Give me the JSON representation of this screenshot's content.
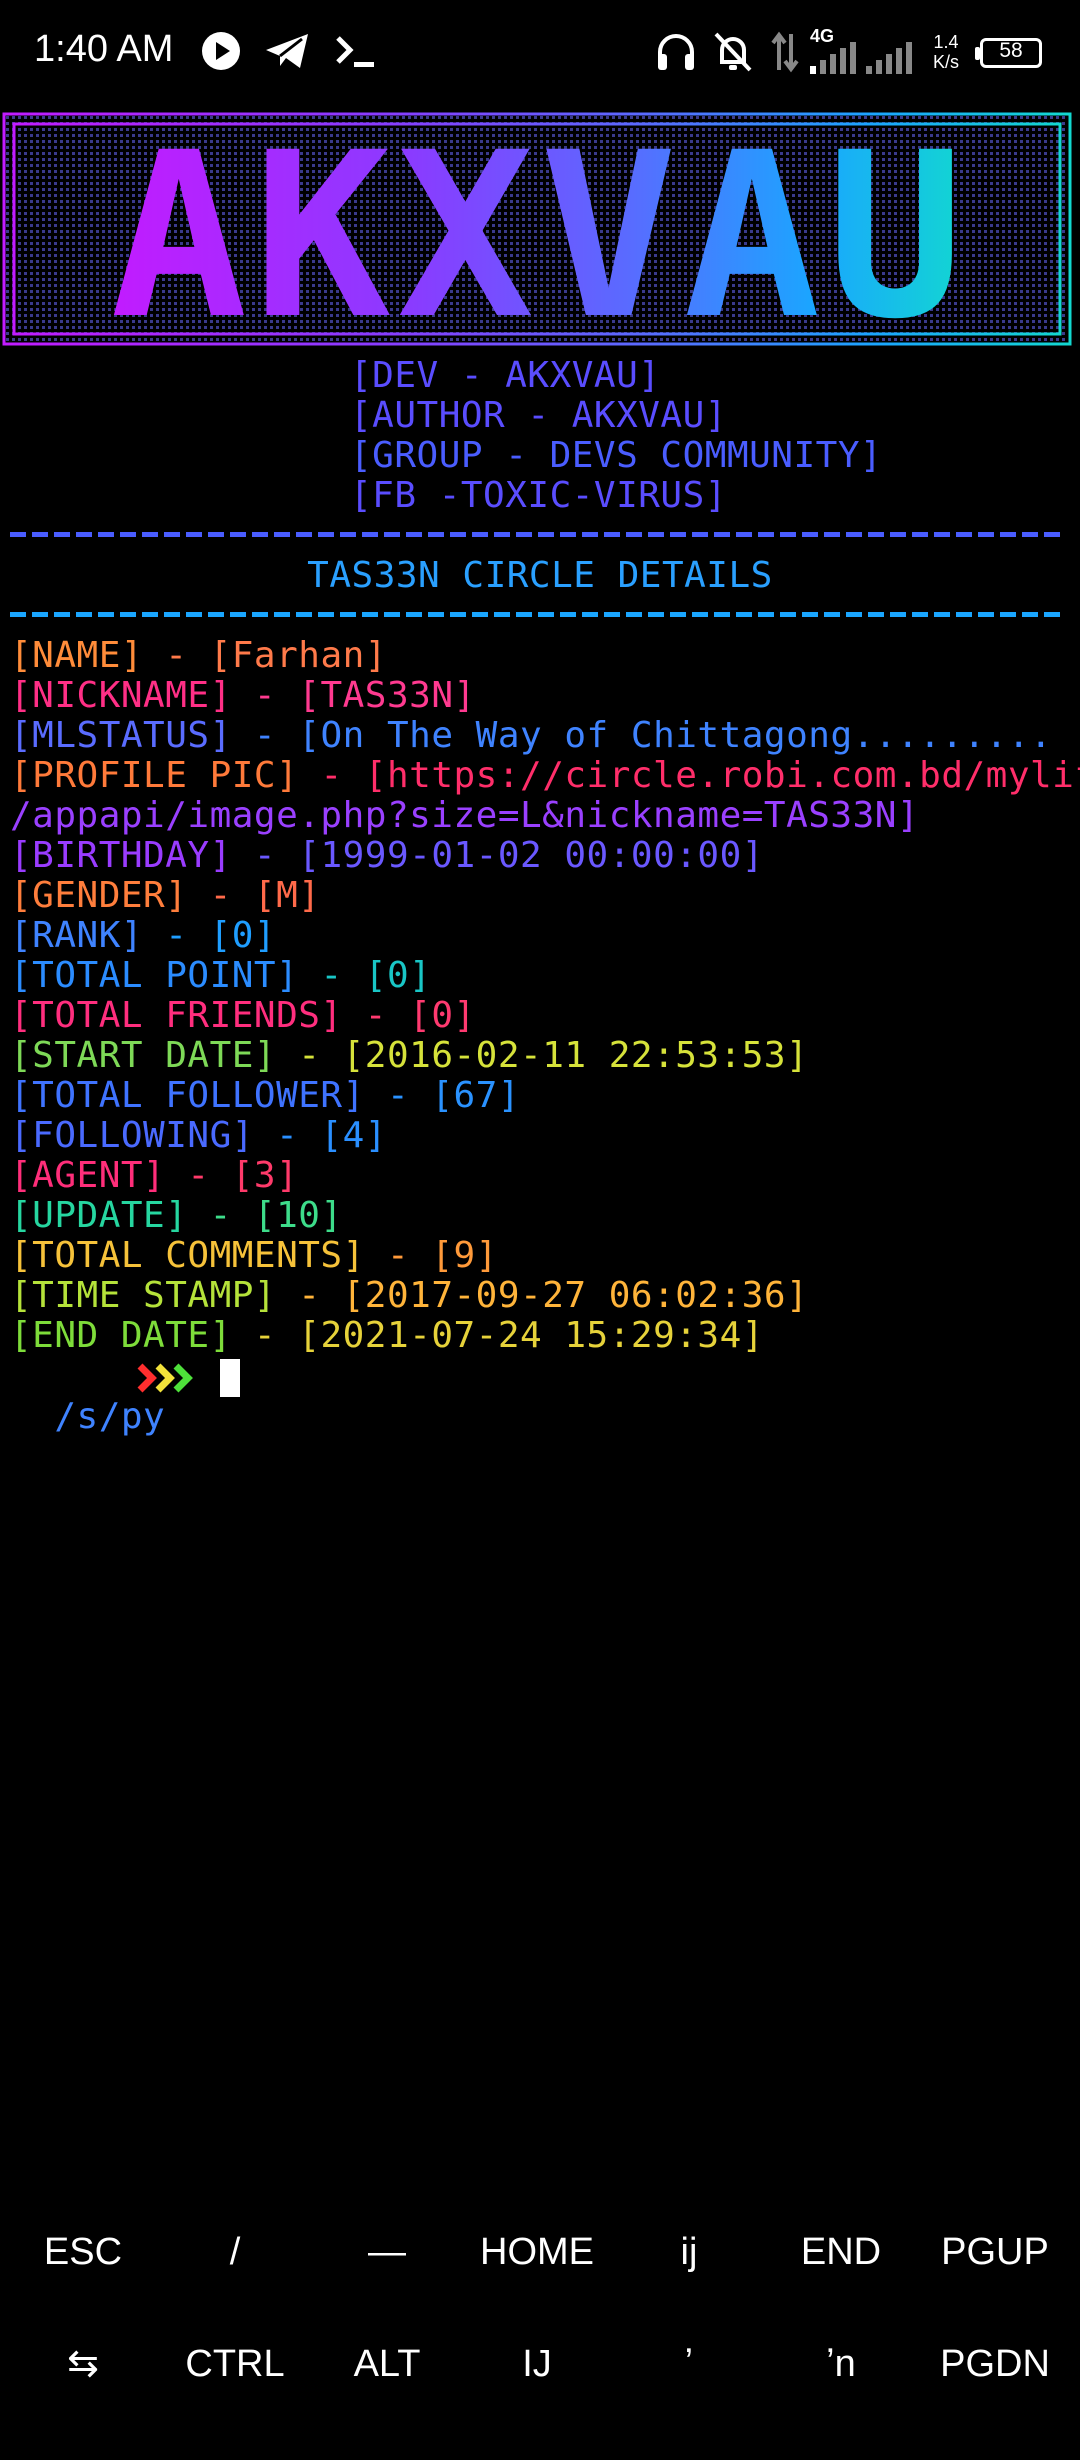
{
  "status_bar": {
    "time": "1:40 AM",
    "network_type": "4G",
    "speed_value": "1.4",
    "speed_unit": "K/s",
    "battery": "58",
    "icons": [
      "play-icon",
      "telegram-icon",
      "terminal-icon",
      "headphones-icon",
      "bell-muted-icon",
      "data-arrows-icon",
      "signal-icon",
      "signal-icon-2",
      "battery-icon"
    ]
  },
  "banner": {
    "logo_text": "AKXVAU",
    "credits": [
      "[DEV - AKXVAU]",
      "[AUTHOR - AKXVAU]",
      "[GROUP - DEVS COMMUNITY]",
      "[FB -TOXIC-VIRUS]"
    ]
  },
  "section_title": "TAS33N CIRCLE DETAILS",
  "details": [
    {
      "label": "[NAME]",
      "sep": " - ",
      "value": "[Farhan]",
      "lc": "#ff8c3a",
      "vc": "#ff7a4a"
    },
    {
      "label": "[NICKNAME]",
      "sep": " - ",
      "value": "[TAS33N]",
      "lc": "#ff2f86",
      "vc": "#ff3a90"
    },
    {
      "label": "[MLSTATUS]",
      "sep": " - ",
      "value": "[On The Way of Chittagong.........  ]",
      "lc": "#5a6cff",
      "vc": "#3f83ff"
    },
    {
      "label": "[PROFILE PIC]",
      "sep": " - ",
      "value": "[https://circle.robi.com.bd/mylife",
      "lc": "#ff7a3a",
      "vc": "#ff2e6a"
    },
    {
      "label": "",
      "sep": "",
      "value": "/appapi/image.php?size=L&nickname=TAS33N]",
      "lc": "#b433ff",
      "vc": "#9a40ff"
    },
    {
      "label": "[BIRTHDAY]",
      "sep": " - ",
      "value": "[1999-01-02 00:00:00]",
      "lc": "#9a3cff",
      "vc": "#6a58ff"
    },
    {
      "label": "[GENDER]",
      "sep": " - ",
      "value": "[M]",
      "lc": "#ff7e3c",
      "vc": "#ff6a4a"
    },
    {
      "label": "[RANK]",
      "sep": " - ",
      "value": "[0]",
      "lc": "#3f83ff",
      "vc": "#1f9eff"
    },
    {
      "label": "[TOTAL POINT]",
      "sep": " - ",
      "value": "[0]",
      "lc": "#2b8cff",
      "vc": "#19c6c6"
    },
    {
      "label": "[TOTAL FRIENDS]",
      "sep": " - ",
      "value": "[0]",
      "lc": "#ff2e7e",
      "vc": "#ff3a70"
    },
    {
      "label": "[START DATE]",
      "sep": " - ",
      "value": "[2016-02-11 22:53:53]",
      "lc": "#7ed957",
      "vc": "#d6e23a"
    },
    {
      "label": "[TOTAL FOLLOWER]",
      "sep": " - ",
      "value": "[67]",
      "lc": "#3f73ff",
      "vc": "#2a92ff"
    },
    {
      "label": "[FOLLOWING]",
      "sep": " - ",
      "value": "[4]",
      "lc": "#4a6aff",
      "vc": "#2a8fff"
    },
    {
      "label": "[AGENT]",
      "sep": " - ",
      "value": "[3]",
      "lc": "#ff2e7a",
      "vc": "#ff3a6a"
    },
    {
      "label": "[UPDATE]",
      "sep": " - ",
      "value": "[10]",
      "lc": "#26d6a0",
      "vc": "#3ddc8a"
    },
    {
      "label": "[TOTAL COMMENTS]",
      "sep": " - ",
      "value": "[9]",
      "lc": "#f6c23a",
      "vc": "#ff9a3a"
    },
    {
      "label": "[TIME STAMP]",
      "sep": " - ",
      "value": "[2017-09-27 06:02:36]",
      "lc": "#b5e23a",
      "vc": "#ffb43a"
    },
    {
      "label": "[END DATE]",
      "sep": " - ",
      "value": "[2021-07-24 15:29:34]",
      "lc": "#7edc3a",
      "vc": "#e6d23a"
    }
  ],
  "prompt": {
    "path": "/s/py"
  },
  "extra_keys": {
    "row1": [
      "ESC",
      "/",
      "—",
      "HOME",
      "ij",
      "END",
      "PGUP"
    ],
    "row2": [
      "⇆",
      "CTRL",
      "ALT",
      "IJ",
      "ʼ",
      "ʼn",
      "PGDN"
    ]
  },
  "colors": {
    "background": "#000000",
    "title": "#2aa0ff",
    "credits": "#5a4dff"
  }
}
